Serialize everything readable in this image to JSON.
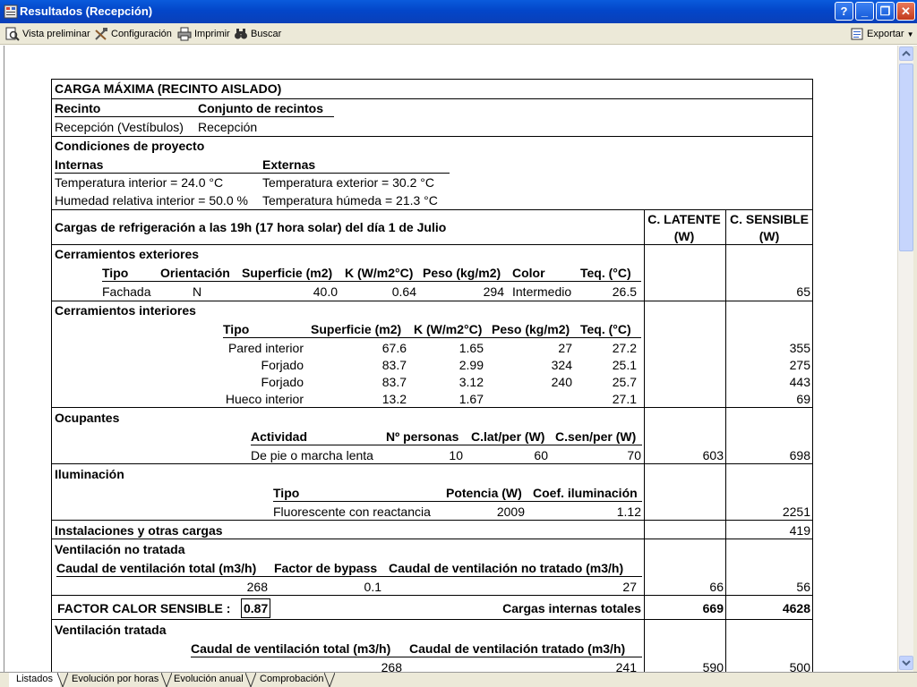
{
  "window": {
    "title": "Resultados (Recepción)",
    "buttons": [
      "?",
      "_",
      "❐",
      "✕"
    ]
  },
  "toolbar": {
    "preview": "Vista preliminar",
    "config": "Configuración",
    "print": "Imprimir",
    "search": "Buscar",
    "export": "Exportar"
  },
  "tabs": [
    "Listados",
    "Evolución por horas",
    "Evolución anual",
    "Comprobación"
  ],
  "report": {
    "title": "CARGA MÁXIMA (RECINTO AISLADO)",
    "recinto_label": "Recinto",
    "conjunto_label": "Conjunto de recintos",
    "recinto_value": "Recepción (Vestíbulos)",
    "conjunto_value": "Recepción",
    "condiciones": "Condiciones de proyecto",
    "internas": "Internas",
    "externas": "Externas",
    "temp_int": "Temperatura interior = 24.0 °C",
    "hum_int": "Humedad relativa interior = 50.0 %",
    "temp_ext": "Temperatura exterior = 30.2 °C",
    "temp_hum": "Temperatura húmeda = 21.3 °C",
    "cargas_title": "Cargas de refrigeración a las 19h (17 hora solar) del día 1 de Julio",
    "c_latente": "C. LATENTE",
    "c_sensible": "C. SENSIBLE",
    "unit_w": "(W)",
    "cer_ext": {
      "title": "Cerramientos exteriores",
      "headers": [
        "Tipo",
        "Orientación",
        "Superficie (m2)",
        "K (W/m2°C)",
        "Peso (kg/m2)",
        "Color",
        "Teq. (°C)"
      ],
      "row": [
        "Fachada",
        "N",
        "40.0",
        "0.64",
        "294",
        "Intermedio",
        "26.5"
      ],
      "sensible": "65"
    },
    "cer_int": {
      "title": "Cerramientos interiores",
      "headers": [
        "Tipo",
        "Superficie (m2)",
        "K (W/m2°C)",
        "Peso (kg/m2)",
        "Teq. (°C)"
      ],
      "rows": [
        [
          "Pared interior",
          "67.6",
          "1.65",
          "27",
          "27.2",
          "355"
        ],
        [
          "Forjado",
          "83.7",
          "2.99",
          "324",
          "25.1",
          "275"
        ],
        [
          "Forjado",
          "83.7",
          "3.12",
          "240",
          "25.7",
          "443"
        ],
        [
          "Hueco interior",
          "13.2",
          "1.67",
          "",
          "27.1",
          "69"
        ]
      ]
    },
    "ocupantes": {
      "title": "Ocupantes",
      "headers": [
        "Actividad",
        "Nº personas",
        "C.lat/per (W)",
        "C.sen/per (W)"
      ],
      "row": [
        "De pie o marcha lenta",
        "10",
        "60",
        "70"
      ],
      "latente": "603",
      "sensible": "698"
    },
    "iluminacion": {
      "title": "Iluminación",
      "headers": [
        "Tipo",
        "Potencia (W)",
        "Coef. iluminación"
      ],
      "row": [
        "Fluorescente con reactancia",
        "2009",
        "1.12"
      ],
      "sensible": "2251"
    },
    "instalaciones": {
      "title": "Instalaciones y otras cargas",
      "sensible": "419"
    },
    "vent_no": {
      "title": "Ventilación no tratada",
      "headers": [
        "Caudal de ventilación total (m3/h)",
        "Factor de bypass",
        "Caudal de ventilación no tratado (m3/h)"
      ],
      "row": [
        "268",
        "0.1",
        "27"
      ],
      "latente": "66",
      "sensible": "56"
    },
    "factor_label": "FACTOR CALOR SENSIBLE :",
    "factor_value": "0.87",
    "internas_totales": "Cargas internas totales",
    "internas_latente": "669",
    "internas_sensible": "4628",
    "vent_tr": {
      "title": "Ventilación tratada",
      "headers": [
        "Caudal de ventilación total (m3/h)",
        "Caudal de ventilación tratado (m3/h)"
      ],
      "row": [
        "268",
        "241"
      ],
      "latente": "590",
      "sensible": "500"
    }
  }
}
